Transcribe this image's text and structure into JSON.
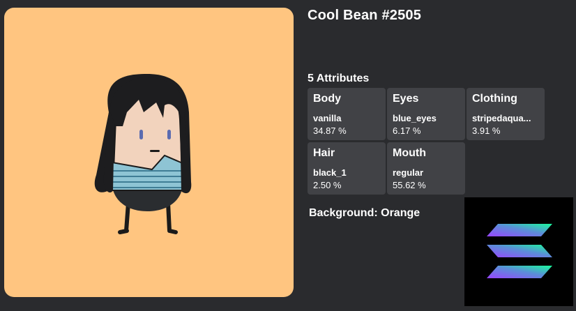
{
  "nft": {
    "title": "Cool Bean #2505",
    "attributes_heading": "5 Attributes",
    "attributes": [
      {
        "name": "Body",
        "value": "vanilla",
        "percent": "34.87 %"
      },
      {
        "name": "Eyes",
        "value": "blue_eyes",
        "percent": "6.17 %"
      },
      {
        "name": "Clothing",
        "value": "stripedaqua...",
        "percent": "3.91 %"
      },
      {
        "name": "Hair",
        "value": "black_1",
        "percent": "2.50 %"
      },
      {
        "name": "Mouth",
        "value": "regular",
        "percent": "55.62 %"
      }
    ],
    "background_line": "Background: Orange",
    "art_background_color": "#ffc580",
    "badge_icon": "solana-logo-icon"
  }
}
